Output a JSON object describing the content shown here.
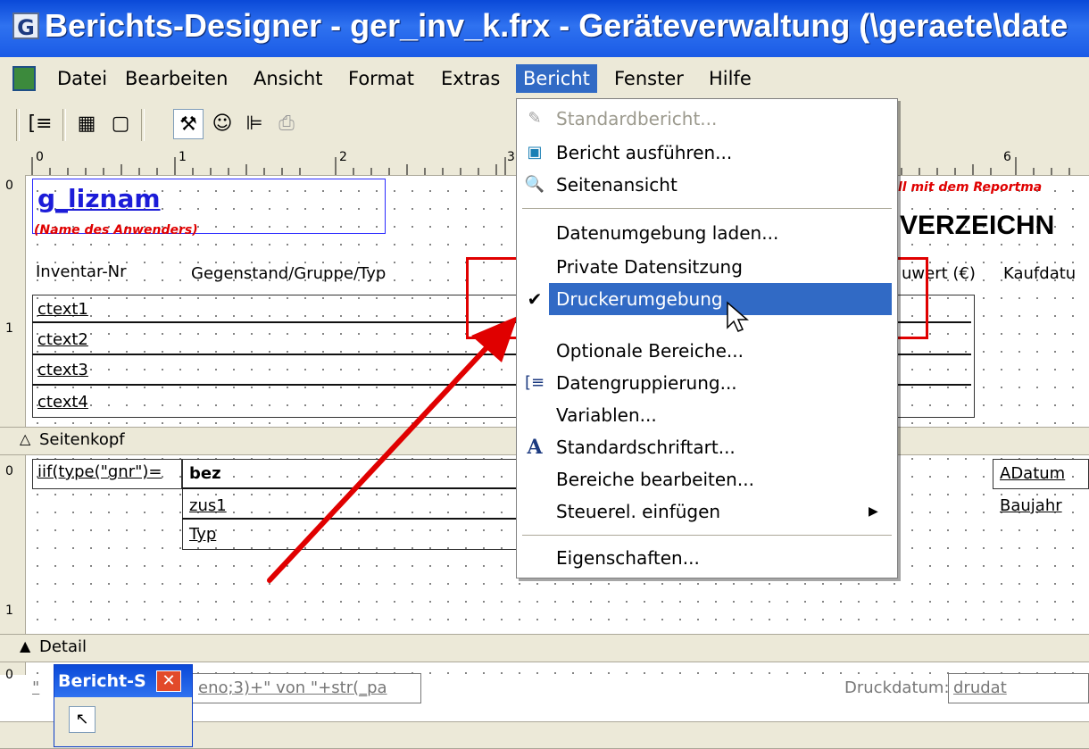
{
  "window": {
    "title": "Berichts-Designer - ger_inv_k.frx - Geräteverwaltung (\\geraete\\date"
  },
  "menubar": {
    "items": [
      "Datei",
      "Bearbeiten",
      "Ansicht",
      "Format",
      "Extras",
      "Bericht",
      "Fenster",
      "Hilfe"
    ],
    "active": "Bericht"
  },
  "toolbar": {
    "buttons": [
      "data-grouping-icon",
      "data-environment-icon",
      "page-setup-icon",
      "report-controls-icon",
      "color-palette-icon",
      "layout-icon",
      "print-icon"
    ]
  },
  "ruler": {
    "h_labels": [
      "0",
      "1",
      "2",
      "3",
      "6"
    ],
    "v_labels": [
      "0",
      "1",
      "0",
      "1",
      "0"
    ]
  },
  "report": {
    "title_field": "g_liznam",
    "subtitle_field": "(Name des Anwenders)",
    "red_note": "ll mit dem Reportma",
    "heading_fragment": "VERZEICHN",
    "columns": [
      "Inventar-Nr",
      "Gegenstand/Gruppe/Typ",
      "uwert (€)",
      "Kaufdatu"
    ],
    "text_fields": [
      "ctext1",
      "ctext2",
      "ctext3",
      "ctext4"
    ],
    "band_seitenkopf": "Seitenkopf",
    "band_detail": "Detail",
    "detail_expr": "iif(type(\"gnr\")=",
    "detail_fields": [
      "bez",
      "zus1",
      "Typ"
    ],
    "detail_right": [
      "ADatum",
      "Baujahr"
    ],
    "footer_left": "\"",
    "footer_expr": "eno;3)+\" von \"+str(_pa",
    "footer_label": "Druckdatum:",
    "footer_field": "drudat"
  },
  "bericht_menu": {
    "items": [
      {
        "label": "Standardbericht...",
        "enabled": false,
        "icon": "standard-report-icon"
      },
      {
        "label": "Bericht ausführen...",
        "enabled": true,
        "icon": "run-report-icon"
      },
      {
        "label": "Seitenansicht",
        "enabled": true,
        "icon": "preview-icon"
      },
      {
        "label": "Datenumgebung laden...",
        "enabled": true
      },
      {
        "label": "Private Datensitzung",
        "enabled": true
      },
      {
        "label": "Druckerumgebung",
        "enabled": true,
        "checked": true,
        "highlighted": true
      },
      {
        "label": "Optionale Bereiche...",
        "enabled": true
      },
      {
        "label": "Datengruppierung...",
        "enabled": true,
        "icon": "data-grouping-icon"
      },
      {
        "label": "Variablen...",
        "enabled": true
      },
      {
        "label": "Standardschriftart...",
        "enabled": true,
        "icon": "font-icon"
      },
      {
        "label": "Bereiche bearbeiten...",
        "enabled": true
      },
      {
        "label": "Steuerel. einfügen",
        "enabled": true,
        "submenu": true
      },
      {
        "label": "Eigenschaften...",
        "enabled": true
      }
    ]
  },
  "toolbox": {
    "title": "Bericht-S"
  },
  "colors": {
    "accent": "#316ac5",
    "title_blue": "#0a49d8",
    "annotation_red": "#e00000"
  }
}
